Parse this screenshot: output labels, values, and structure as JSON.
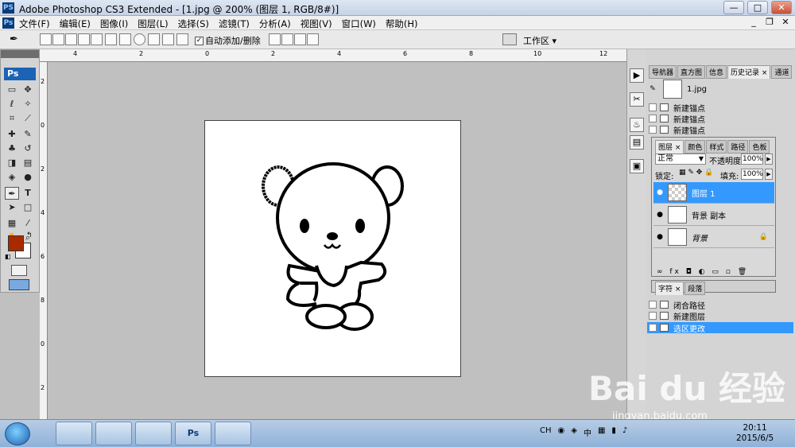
{
  "window": {
    "app_icon": "PS",
    "title": "Adobe Photoshop CS3 Extended - [1.jpg @ 200% (图层 1, RGB/8#)]",
    "controls": {
      "minimize": "—",
      "maximize": "□",
      "close": "✕"
    }
  },
  "menubar": {
    "app_icon": "Ps",
    "items": [
      "文件(F)",
      "编辑(E)",
      "图像(I)",
      "图层(L)",
      "选择(S)",
      "滤镜(T)",
      "分析(A)",
      "视图(V)",
      "窗口(W)",
      "帮助(H)"
    ],
    "doc_controls": {
      "minimize": "_",
      "restore": "❐",
      "close": "✕"
    }
  },
  "options": {
    "auto_add": "自动添加/删除",
    "auto_add_checked": true,
    "workspace": "工作区 ▾"
  },
  "toolbox": {
    "logo": "Ps"
  },
  "ruler": {
    "top_ticks": [
      "4",
      "2",
      "0",
      "2",
      "4",
      "6",
      "8",
      "10",
      "12"
    ],
    "left_ticks": [
      "2",
      "0",
      "2",
      "4",
      "6",
      "8",
      "0",
      "2"
    ]
  },
  "history": {
    "tabs": [
      "导航器",
      "直方图",
      "信息",
      "历史记录 ×",
      "通道"
    ],
    "active_tab": "历史记录 ×",
    "snapshot_name": "1.jpg",
    "items_top": [
      "新建锚点",
      "新建锚点",
      "新建锚点"
    ],
    "items_bottom": [
      "闭合路径",
      "新建图层",
      "选区更改"
    ],
    "selected": "选区更改"
  },
  "layers": {
    "tabs": [
      "图层 ×",
      "颜色",
      "样式",
      "路径",
      "色板"
    ],
    "active_tab": "图层 ×",
    "blend_mode": "正常",
    "opacity_label": "不透明度:",
    "opacity_value": "100%",
    "lock_label": "锁定:",
    "fill_label": "填充:",
    "fill_value": "100%",
    "rows": [
      {
        "name": "图层 1",
        "selected": true
      },
      {
        "name": "背景 副本",
        "selected": false
      },
      {
        "name": "背景",
        "selected": false,
        "italic": true
      }
    ]
  },
  "character": {
    "tabs": [
      "字符 ×",
      "段落"
    ]
  },
  "watermark": {
    "brand": "Bai du 经验",
    "url": "jingyan.baidu.com"
  },
  "taskbar": {
    "tasks": [
      "Ps"
    ],
    "lang": "CH",
    "ime": "中",
    "time": "20:11",
    "date": "2015/6/5"
  },
  "colors": {
    "accent": "#3399ff",
    "foreground": "#a82b00",
    "background": "#ffffff"
  }
}
